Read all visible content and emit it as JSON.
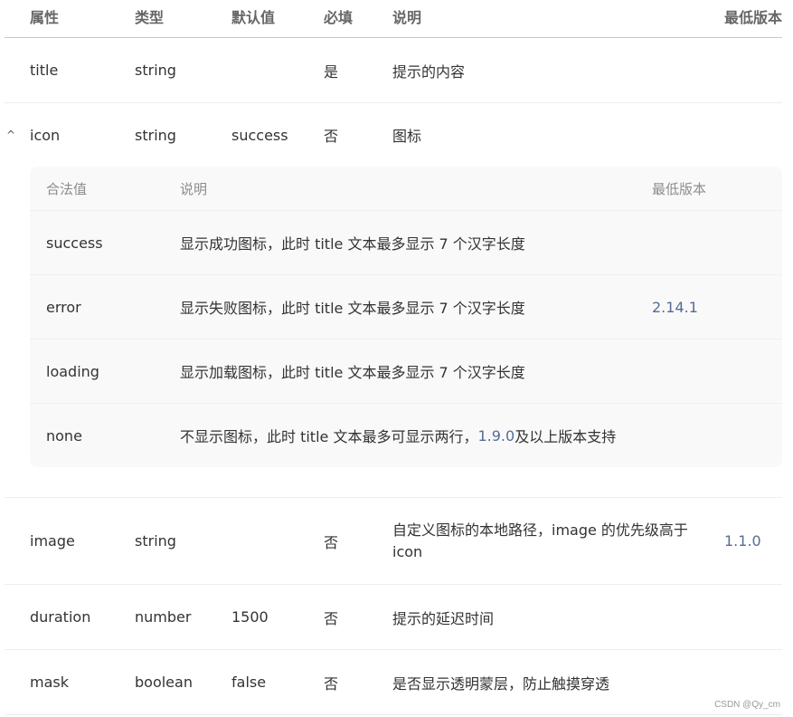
{
  "header": {
    "name": "属性",
    "type": "类型",
    "default": "默认值",
    "required": "必填",
    "desc": "说明",
    "version": "最低版本"
  },
  "rows": [
    {
      "name": "title",
      "type": "string",
      "default": "",
      "required": "是",
      "desc": "提示的内容",
      "version": ""
    },
    {
      "name": "icon",
      "type": "string",
      "default": "success",
      "required": "否",
      "desc": "图标",
      "version": "",
      "expander": "^"
    },
    {
      "name": "image",
      "type": "string",
      "default": "",
      "required": "否",
      "desc": "自定义图标的本地路径，image 的优先级高于 icon",
      "version": "1.1.0"
    },
    {
      "name": "duration",
      "type": "number",
      "default": "1500",
      "required": "否",
      "desc": "提示的延迟时间",
      "version": ""
    },
    {
      "name": "mask",
      "type": "boolean",
      "default": "false",
      "required": "否",
      "desc": "是否显示透明蒙层，防止触摸穿透",
      "version": ""
    }
  ],
  "icon_values": {
    "header": {
      "value": "合法值",
      "desc": "说明",
      "version": "最低版本"
    },
    "rows": [
      {
        "value": "success",
        "desc": "显示成功图标，此时 title 文本最多显示 7 个汉字长度",
        "version": ""
      },
      {
        "value": "error",
        "desc": "显示失败图标，此时 title 文本最多显示 7 个汉字长度",
        "version": "2.14.1"
      },
      {
        "value": "loading",
        "desc": "显示加载图标，此时 title 文本最多显示 7 个汉字长度",
        "version": ""
      },
      {
        "value": "none",
        "desc_prefix": "不显示图标，此时 title 文本最多可显示两行，",
        "desc_link": "1.9.0",
        "desc_suffix": "及以上版本支持",
        "version": ""
      }
    ]
  },
  "watermark": "CSDN @Qy_cm",
  "colors": {
    "link": "#576b95",
    "header_text": "#666666",
    "body_text": "#333333",
    "sub_bg": "#f9f9f9"
  }
}
